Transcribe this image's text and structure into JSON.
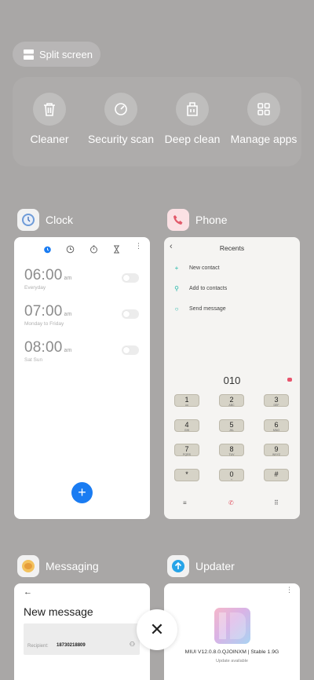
{
  "split_screen": {
    "label": "Split screen",
    "icon": "split-screen-icon"
  },
  "tools": [
    {
      "label": "Cleaner",
      "icon": "trash-icon"
    },
    {
      "label": "Security scan",
      "icon": "security-scan-icon"
    },
    {
      "label": "Deep clean",
      "icon": "deep-clean-icon"
    },
    {
      "label": "Manage apps",
      "icon": "grid-icon"
    }
  ],
  "apps": {
    "clock": {
      "name": "Clock",
      "alarms": [
        {
          "time": "06:00",
          "ampm": "am",
          "repeat": "Everyday"
        },
        {
          "time": "07:00",
          "ampm": "am",
          "repeat": "Monday to Friday"
        },
        {
          "time": "08:00",
          "ampm": "am",
          "repeat": "Sat Sun"
        }
      ],
      "fab": "+"
    },
    "phone": {
      "name": "Phone",
      "title": "Recents",
      "rows": [
        "New contact",
        "Add to contacts",
        "Send message"
      ],
      "dialed": "010",
      "keys": [
        {
          "d": "1",
          "l": "oo"
        },
        {
          "d": "2",
          "l": "ABC"
        },
        {
          "d": "3",
          "l": "DEF"
        },
        {
          "d": "4",
          "l": "GHI"
        },
        {
          "d": "5",
          "l": "JKL"
        },
        {
          "d": "6",
          "l": "MNO"
        },
        {
          "d": "7",
          "l": "PQRS"
        },
        {
          "d": "8",
          "l": "TUV"
        },
        {
          "d": "9",
          "l": "WXYZ"
        },
        {
          "d": "*",
          "l": ""
        },
        {
          "d": "0",
          "l": "+"
        },
        {
          "d": "#",
          "l": ""
        }
      ]
    },
    "messaging": {
      "name": "Messaging",
      "title": "New message",
      "recipient_label": "Recipient:",
      "recipient_value": "18730218809"
    },
    "updater": {
      "name": "Updater",
      "version": "MIUI V12.0.8.0.QJOINXM | Stable 1.9G",
      "status": "Update available"
    }
  },
  "close": "✕"
}
